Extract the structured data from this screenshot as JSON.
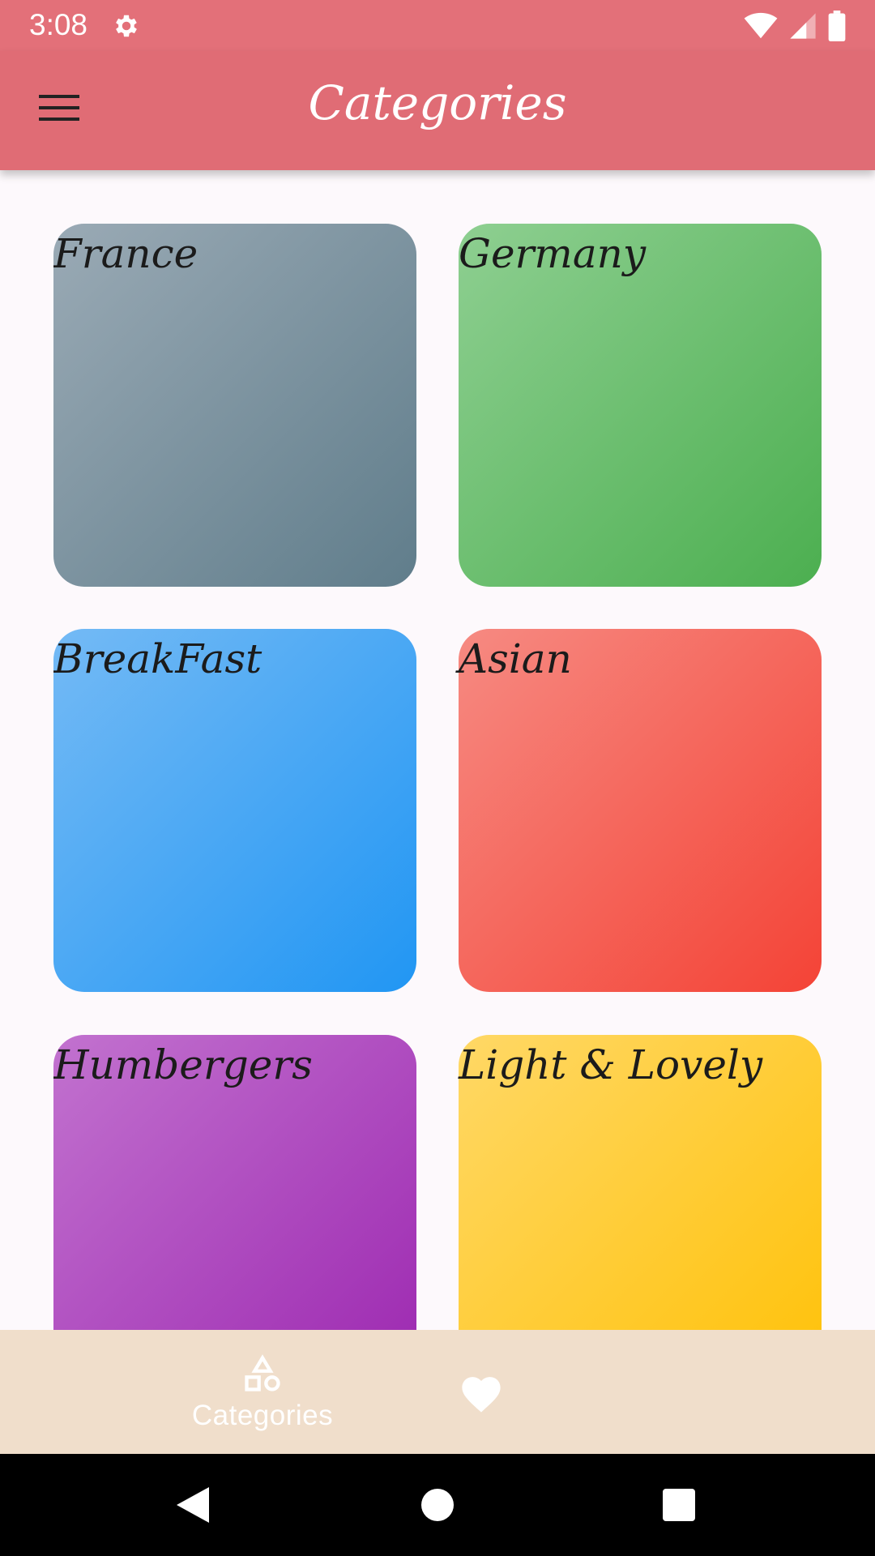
{
  "status_bar": {
    "time": "3:08",
    "icons": [
      "settings-icon",
      "wifi-icon",
      "signal-icon",
      "battery-icon"
    ]
  },
  "app_bar": {
    "title": "Categories",
    "menu_icon": "hamburger-menu-icon"
  },
  "categories": [
    {
      "label": "France",
      "color_start": "#9AAAB5",
      "color_end": "#607D8B"
    },
    {
      "label": "Germany",
      "color_start": "#8ECF91",
      "color_end": "#4CAF50"
    },
    {
      "label": "BreakFast",
      "color_start": "#74BAF5",
      "color_end": "#2196F3"
    },
    {
      "label": "Asian",
      "color_start": "#F68A82",
      "color_end": "#F44336"
    },
    {
      "label": "Humbergers",
      "color_start": "#C272CF",
      "color_end": "#9C27B0"
    },
    {
      "label": "Light & Lovely",
      "color_start": "#FFD866",
      "color_end": "#FFC107"
    }
  ],
  "bottom_nav": {
    "items": [
      {
        "label": "Categories",
        "icon": "categories-shapes-icon",
        "selected": true
      },
      {
        "label": "",
        "icon": "heart-icon",
        "selected": false
      }
    ]
  },
  "system_nav": {
    "icons": [
      "back-icon",
      "home-icon",
      "recents-icon"
    ]
  },
  "colors": {
    "app_bar": "#E06C75",
    "status_bar": "#E37079",
    "bottom_nav": "#F0DECB",
    "background": "#FDF9FC"
  }
}
